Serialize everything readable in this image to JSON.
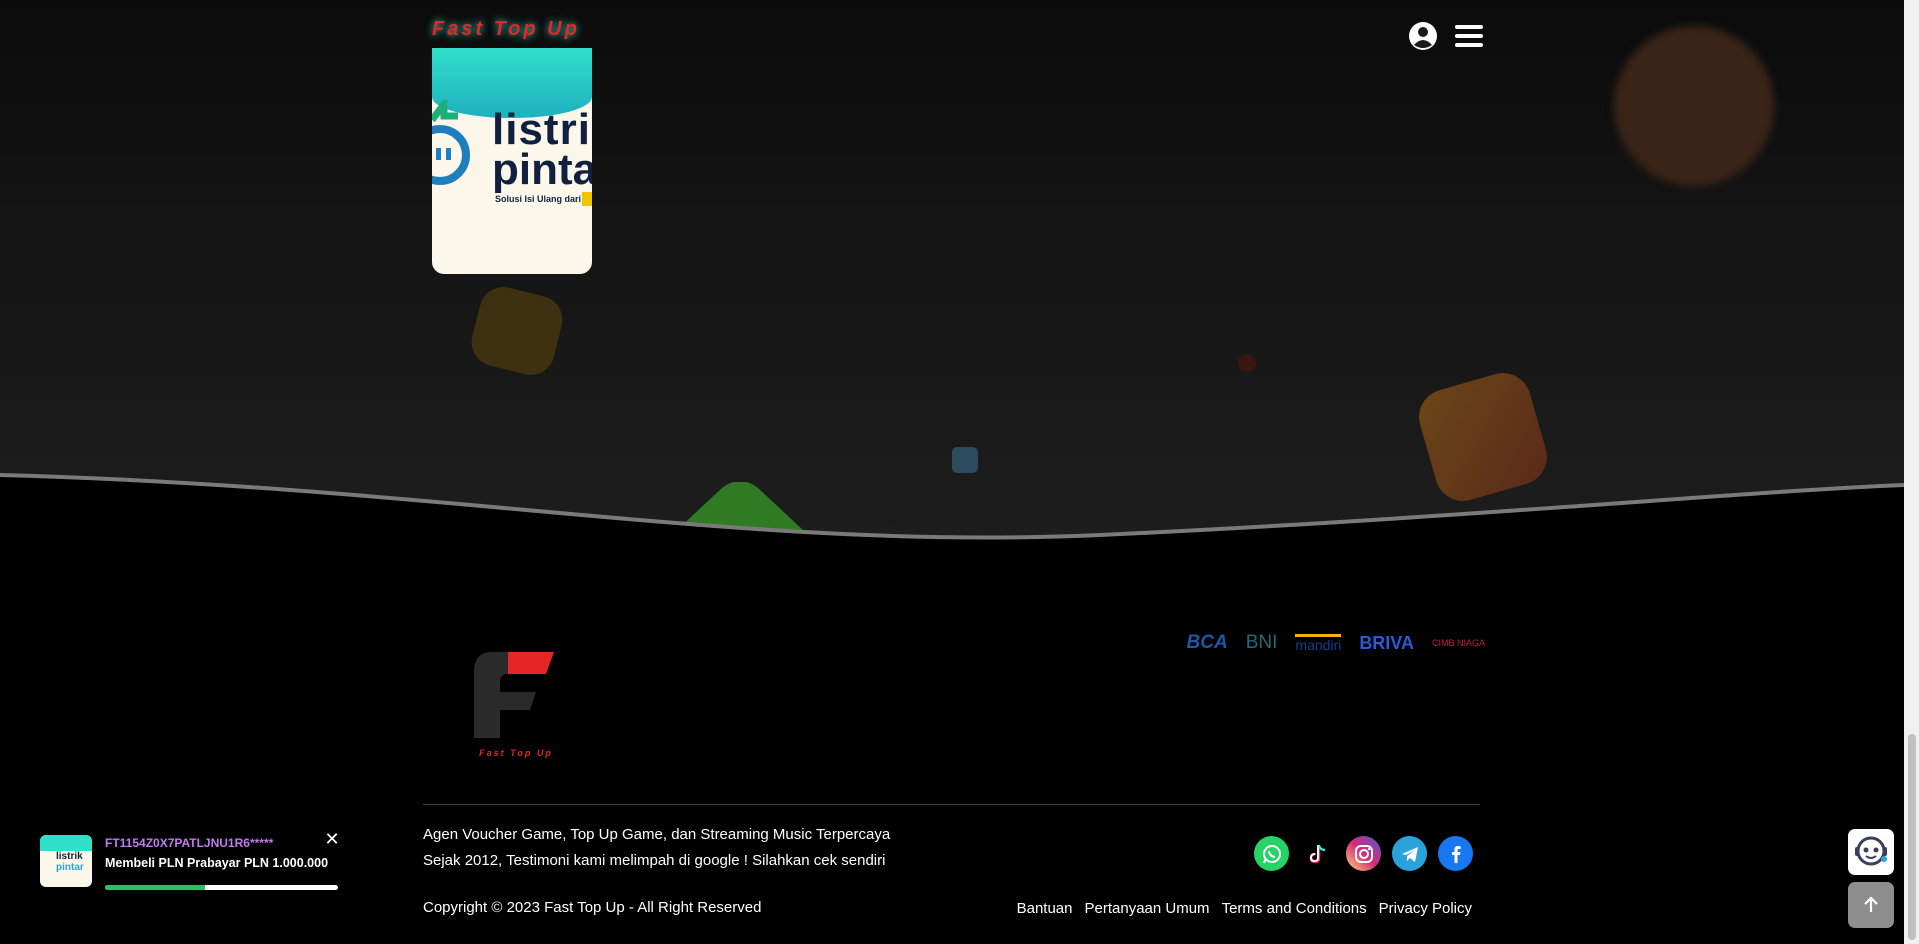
{
  "header": {
    "brand": "Fast Top Up",
    "account_icon": "user-circle-icon",
    "menu_icon": "hamburger-menu-icon"
  },
  "product_card": {
    "title_line1": "listri",
    "title_line2": "pinta",
    "tagline": "Solusi Isi Ulang dari"
  },
  "footer": {
    "logo_text": "Fast Top Up",
    "banks": [
      "BCA",
      "BNI",
      "mandiri",
      "BRIVA",
      "CIMB NIAGA"
    ],
    "description_line1": "Agen Voucher Game, Top Up Game, dan Streaming Music Terpercaya",
    "description_line2": "Sejak 2012, Testimoni kami melimpah di google ! Silahkan cek sendiri",
    "copyright": "Copyright © 2023 Fast Top Up - All Right Reserved",
    "links": [
      "Bantuan",
      "Pertanyaan Umum",
      "Terms and Conditions",
      "Privacy Policy"
    ],
    "social": [
      {
        "icon": "whatsapp-icon",
        "color": "#25d366"
      },
      {
        "icon": "tiktok-icon",
        "color": "#000000"
      },
      {
        "icon": "instagram-icon",
        "color": "#d62976"
      },
      {
        "icon": "telegram-icon",
        "color": "#2aa3dd"
      },
      {
        "icon": "facebook-icon",
        "color": "#1877f2"
      }
    ]
  },
  "toast": {
    "order_id": "FT1154Z0X7PATLJNU1R6*****",
    "message": "Membeli PLN Prabayar PLN 1.000.000",
    "close_glyph": "✕",
    "progress": 0.43,
    "thumb_line1": "listrik",
    "thumb_line2": "pintar"
  },
  "widgets": {
    "chatbot_icon": "chatbot-icon",
    "back_to_top_icon": "arrow-up-icon"
  },
  "colors": {
    "brand_red": "#e32626",
    "accent_teal": "#2de0c8",
    "toast_id": "#c27af0",
    "progress": "#2fbf63"
  }
}
